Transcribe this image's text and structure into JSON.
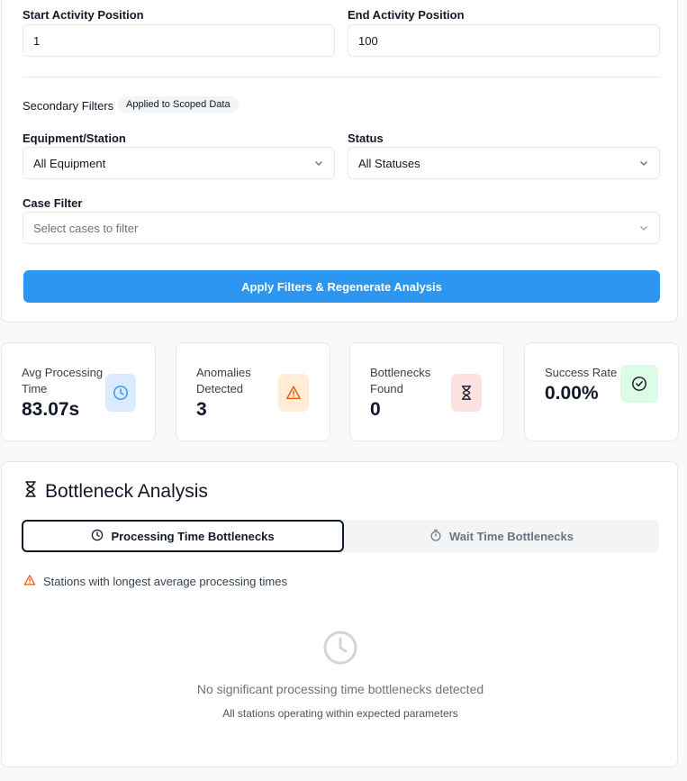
{
  "filters": {
    "start_label": "Start Activity Position",
    "start_value": "1",
    "end_label": "End Activity Position",
    "end_value": "100",
    "secondary_label": "Secondary Filters",
    "secondary_badge": "Applied to Scoped Data",
    "equipment_label": "Equipment/Station",
    "equipment_value": "All Equipment",
    "status_label": "Status",
    "status_value": "All Statuses",
    "case_label": "Case Filter",
    "case_placeholder": "Select cases to filter",
    "apply_label": "Apply Filters & Regenerate Analysis"
  },
  "stats": [
    {
      "label": "Avg Processing Time",
      "value": "83.07s",
      "icon": "clock-icon",
      "color": "#2c96f0",
      "bg": "#dbeafe"
    },
    {
      "label": "Anomalies Detected",
      "value": "3",
      "icon": "warning-icon",
      "color": "#ea580c",
      "bg": "#ffedd5"
    },
    {
      "label": "Bottlenecks Found",
      "value": "0",
      "icon": "hourglass-icon",
      "color": "#111827",
      "bg": "#fee2e2"
    },
    {
      "label": "Success Rate",
      "value": "0.00%",
      "icon": "check-circle-icon",
      "color": "#111827",
      "bg": "#dcfce7"
    }
  ],
  "bottleneck": {
    "title": "Bottleneck Analysis",
    "tab_processing": "Processing Time Bottlenecks",
    "tab_wait": "Wait Time Bottlenecks",
    "note": "Stations with longest average processing times",
    "empty_title": "No significant processing time bottlenecks detected",
    "empty_sub": "All stations operating within expected parameters"
  },
  "colors": {
    "accent": "#2c96f0",
    "warning": "#ea580c"
  }
}
